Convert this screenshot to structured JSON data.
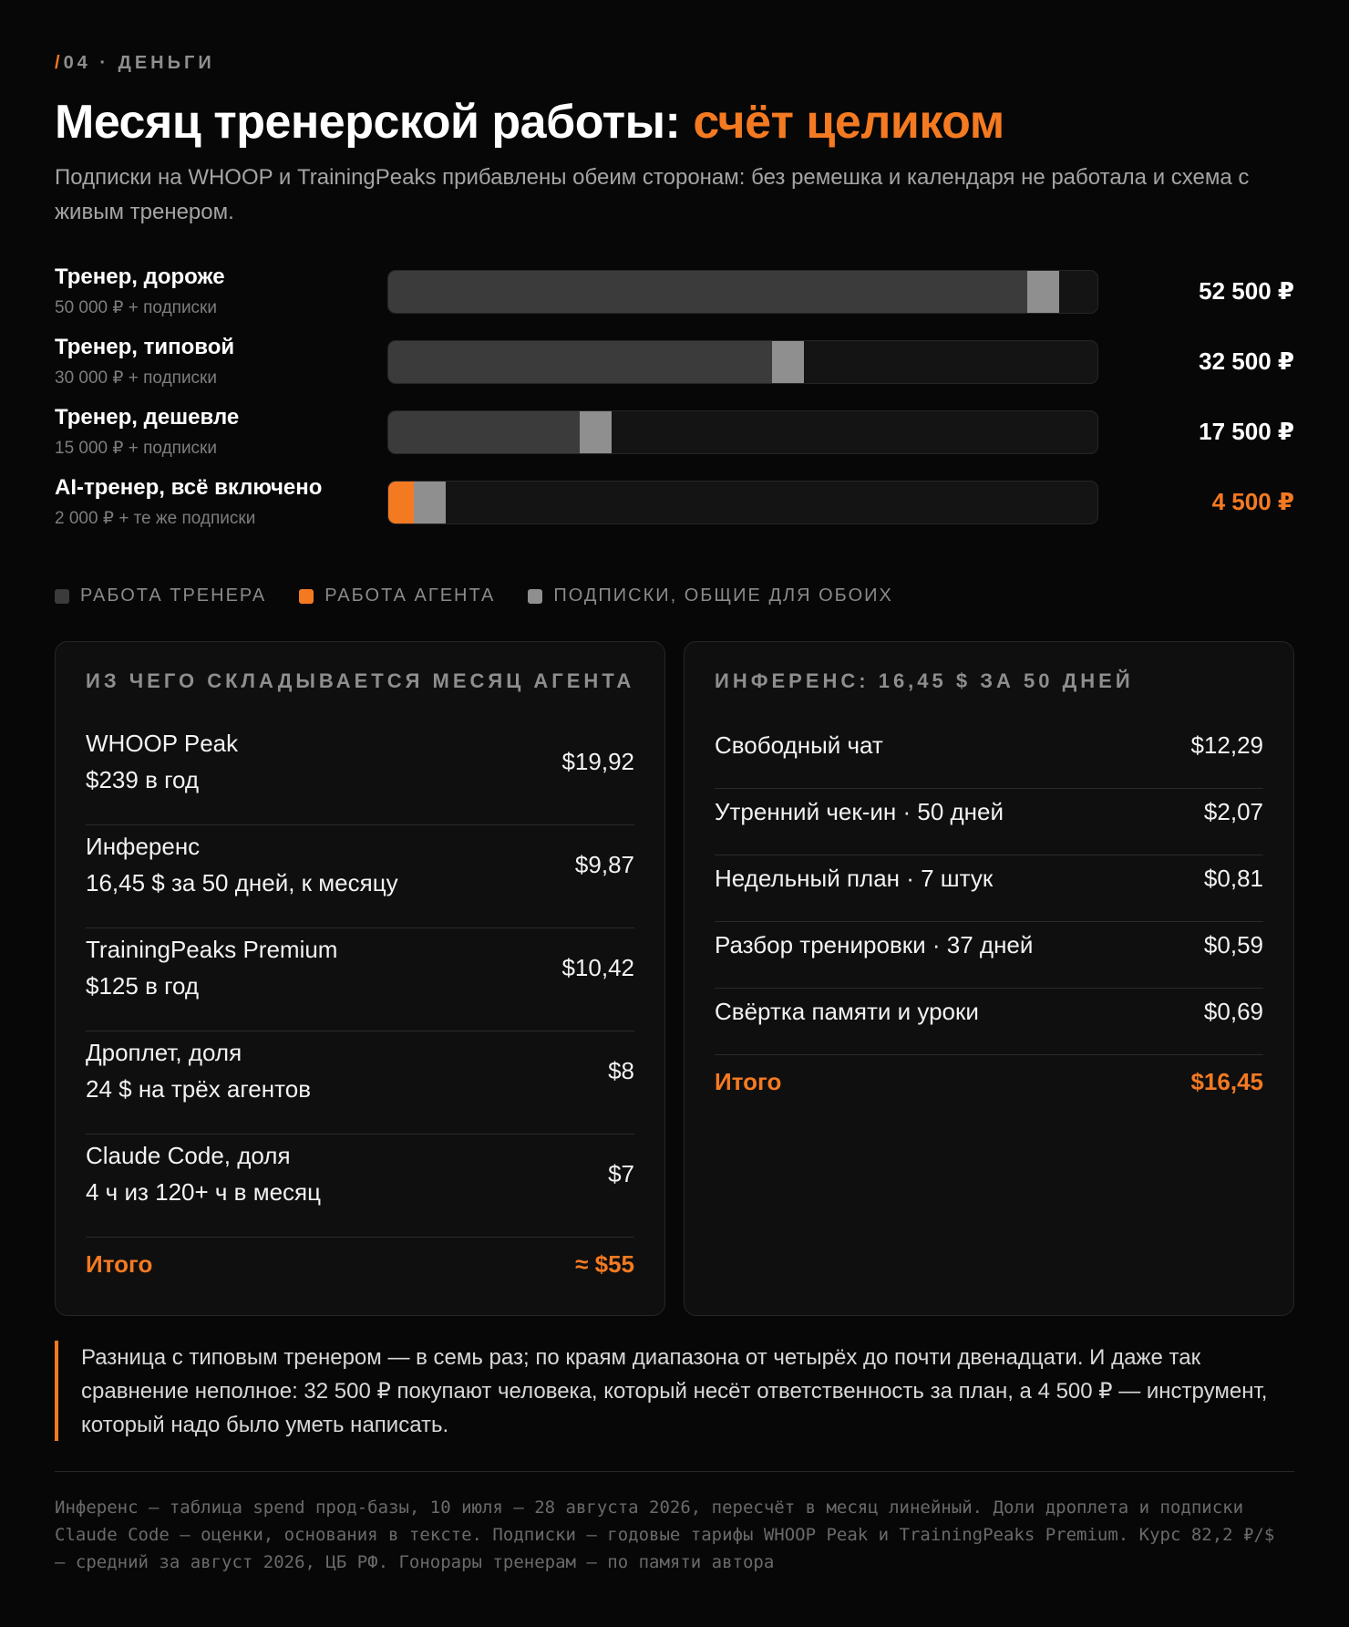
{
  "header": {
    "kicker_slash": "/",
    "kicker": "04 · ДЕНЬГИ",
    "title_main": "Месяц тренерской работы: ",
    "title_accent": "счёт целиком",
    "subtitle": "Подписки на WHOOP и TrainingPeaks прибавлены обеим сторонам: без ремешка и календаря не работала и схема с живым тренером."
  },
  "colors": {
    "background": "#070707",
    "accent": "#f47a22",
    "trainer_work": "#3b3b3b",
    "agent_work": "#f47a22",
    "subscriptions": "#8f8f8f"
  },
  "chart_data": {
    "type": "bar",
    "orientation": "horizontal",
    "stacked": true,
    "unit": "₽",
    "xlim": [
      0,
      55500
    ],
    "categories": [
      "Тренер, дороже",
      "Тренер, типовой",
      "Тренер, дешевле",
      "AI-тренер, всё включено"
    ],
    "category_notes": [
      "50 000 ₽ + подписки",
      "30 000 ₽ + подписки",
      "15 000 ₽ + подписки",
      "2 000 ₽ + те же подписки"
    ],
    "series": [
      {
        "name": "РАБОТА ТРЕНЕРА",
        "key": "trainer",
        "values": [
          50000,
          30000,
          15000,
          0
        ]
      },
      {
        "name": "РАБОТА АГЕНТА",
        "key": "agent",
        "values": [
          0,
          0,
          0,
          2000
        ]
      },
      {
        "name": "ПОДПИСКИ, ОБЩИЕ ДЛЯ ОБОИХ",
        "key": "subs",
        "values": [
          2500,
          2500,
          2500,
          2500
        ]
      }
    ],
    "totals_labels": [
      "52 500 ₽",
      "32 500 ₽",
      "17 500 ₽",
      "4 500 ₽"
    ],
    "highlight_index": 3,
    "legend_position": "bottom-left"
  },
  "left_card": {
    "heading": "ИЗ ЧЕГО СКЛАДЫВАЕТСЯ МЕСЯЦ АГЕНТА",
    "rows": [
      {
        "name": "WHOOP Peak",
        "detail": "$239 в год",
        "value": "$19,92"
      },
      {
        "name": "Инференс",
        "detail": "16,45 $ за 50 дней, к месяцу",
        "value": "$9,87"
      },
      {
        "name": "TrainingPeaks Premium",
        "detail": "$125 в год",
        "value": "$10,42"
      },
      {
        "name": "Дроплет, доля",
        "detail": "24 $ на трёх агентов",
        "value": "$8"
      },
      {
        "name": "Claude Code, доля",
        "detail": "4 ч из 120+ ч в месяц",
        "value": "$7"
      }
    ],
    "total_label": "Итого",
    "total_value": "≈ $55"
  },
  "right_card": {
    "heading": "ИНФЕРЕНС: 16,45 $ ЗА 50 ДНЕЙ",
    "rows": [
      {
        "name": "Свободный чат",
        "value": "$12,29"
      },
      {
        "name": "Утренний чек-ин · 50 дней",
        "value": "$2,07"
      },
      {
        "name": "Недельный план · 7 штук",
        "value": "$0,81"
      },
      {
        "name": "Разбор тренировки · 37 дней",
        "value": "$0,59"
      },
      {
        "name": "Свёртка памяти и уроки",
        "value": "$0,69"
      }
    ],
    "total_label": "Итого",
    "total_value": "$16,45"
  },
  "quote": "Разница с типовым тренером — в семь раз; по краям диапазона от четырёх до почти двенадцати. И даже так сравнение неполное: 32 500 ₽ покупают человека, который несёт ответственность за план, а 4 500 ₽ — инструмент, который надо было уметь написать.",
  "footnote": "Инференс — таблица spend прод-базы, 10 июля — 28 августа 2026, пересчёт в месяц линейный. Доли дроплета и подписки Claude Code — оценки, основания в тексте. Подписки — годовые тарифы WHOOP Peak и TrainingPeaks Premium. Курс 82,2 ₽/$ — средний за август 2026, ЦБ РФ. Гонорары тренерам — по памяти автора"
}
